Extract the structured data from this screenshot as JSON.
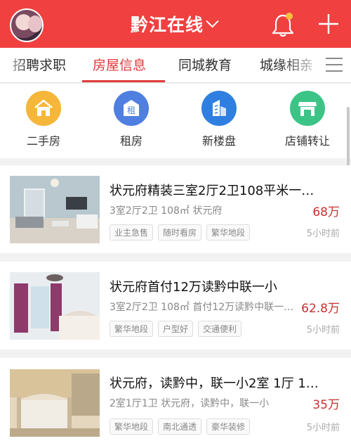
{
  "header": {
    "title": "黔江在线",
    "colors": {
      "background": "#f04040",
      "accent": "#e03a3a",
      "price": "#c83030"
    }
  },
  "tabs": [
    {
      "label": "招聘求职",
      "active": false
    },
    {
      "label": "房屋信息",
      "active": true
    },
    {
      "label": "同城教育",
      "active": false
    },
    {
      "label": "城缘相亲",
      "active": false
    }
  ],
  "categories": [
    {
      "label": "二手房",
      "icon": "house-icon",
      "color": "#f6b63a"
    },
    {
      "label": "租房",
      "icon": "rent-icon",
      "icon_text": "租",
      "color": "#4f7fe0"
    },
    {
      "label": "新楼盘",
      "icon": "building-icon",
      "color": "#2f7fe0"
    },
    {
      "label": "店铺转让",
      "icon": "shop-icon",
      "color": "#3cc487"
    }
  ],
  "listings": [
    {
      "title": "状元府精装三室2厅2卫108平米一…",
      "meta": "3室2厅2卫  108㎡  状元府",
      "price": "68万",
      "tags": [
        "业主急售",
        "随时看房",
        "繁华地段"
      ],
      "time": "5小时前"
    },
    {
      "title": "状元府首付12万读黔中联一小",
      "meta": "3室2厅2卫  108㎡  首付12万读黔中联一…",
      "price": "62.8万",
      "tags": [
        "繁华地段",
        "户型好",
        "交通便利"
      ],
      "time": "5小时前"
    },
    {
      "title": "状元府，读黔中，联一小2室 1厅 1…",
      "meta": "2室1厅1卫  状元府，读黔中，联一小",
      "price": "35万",
      "tags": [
        "繁华地段",
        "南北通透",
        "豪华装修"
      ],
      "time": "5小时前"
    }
  ]
}
